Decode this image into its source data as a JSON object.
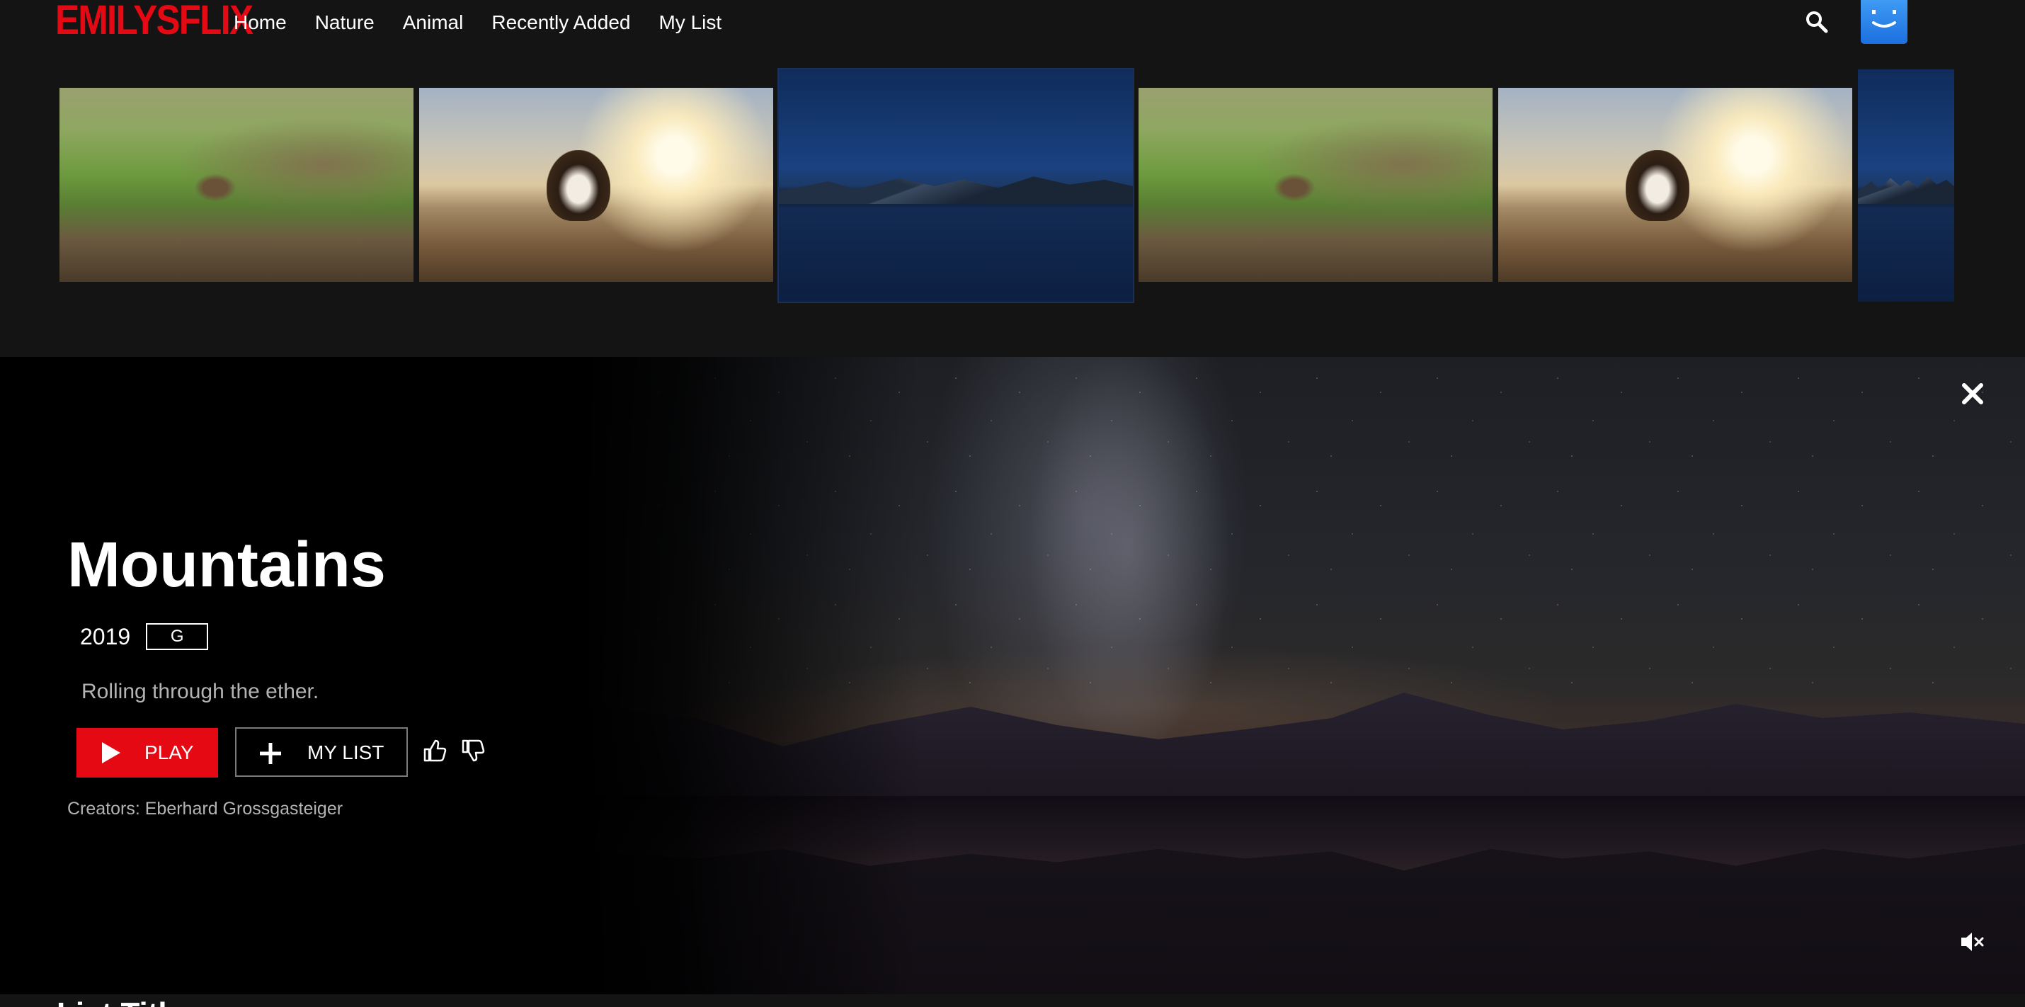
{
  "app": {
    "logo": "EMILYSFLIX",
    "brand_color": "#e50914"
  },
  "nav": {
    "links": [
      "Home",
      "Nature",
      "Animal",
      "Recently Added",
      "My List"
    ],
    "search_icon": "search-icon",
    "avatar_color": "#2a7fe8"
  },
  "thumbnails": [
    {
      "subject": "snipe-bird-in-grass"
    },
    {
      "subject": "puppy-on-beach-at-sunset"
    },
    {
      "subject": "mountain-lake-at-night"
    },
    {
      "subject": "snipe-bird-in-grass"
    },
    {
      "subject": "puppy-on-beach-at-sunset"
    },
    {
      "subject": "mountain-lake-at-night"
    }
  ],
  "hero": {
    "title": "Mountains",
    "year": "2019",
    "rating": "G",
    "tagline": "Rolling through the ether.",
    "play_label": "PLAY",
    "my_list_label": "MY LIST",
    "creators": "Creators: Eberhard Grossgasteiger",
    "close_icon": "close-icon",
    "mute_icon": "mute-icon"
  },
  "next_row": {
    "title": "List Title"
  }
}
